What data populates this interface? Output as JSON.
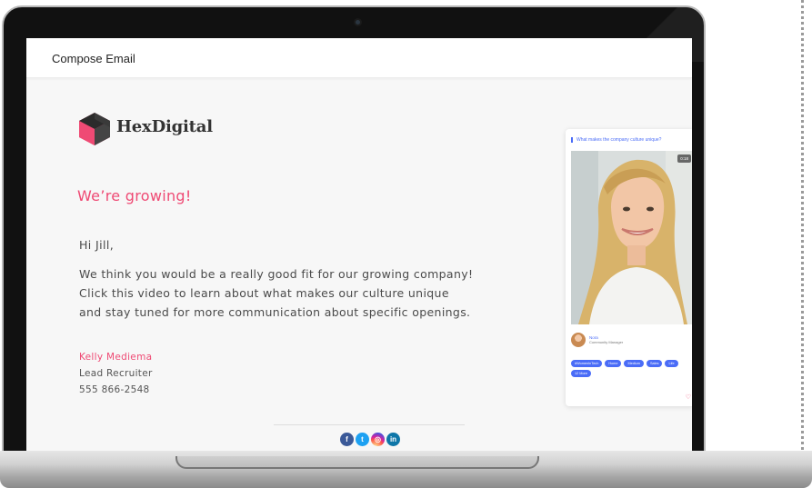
{
  "compose": {
    "title": "Compose Email"
  },
  "brand": {
    "name": "HexDigital",
    "accent": "#ef4a74"
  },
  "email": {
    "headline": "We’re growing!",
    "greeting": "Hi Jill,",
    "body_lines": [
      "We think you would be a really good fit for our growing company!",
      "Click this video to learn about what makes our culture unique",
      "and stay tuned for more communication about specific openings."
    ],
    "signature": {
      "name": "Kelly Mediema",
      "role": "Lead Recruiter",
      "phone": "555 866-2548"
    },
    "socials": [
      {
        "icon": "facebook-icon",
        "glyph": "f"
      },
      {
        "icon": "twitter-icon",
        "glyph": "t"
      },
      {
        "icon": "instagram-icon",
        "glyph": "◎"
      },
      {
        "icon": "linkedin-icon",
        "glyph": "in"
      }
    ]
  },
  "video_card": {
    "question": "What makes the company culture unique?",
    "counter": "0:18",
    "person": {
      "name": "Nora",
      "role": "Community Manager"
    },
    "tags": [
      "#WomenInTech",
      "Home",
      "Medium",
      "Sales",
      "Life",
      "12 More"
    ],
    "accent": "#4a6cf7"
  }
}
